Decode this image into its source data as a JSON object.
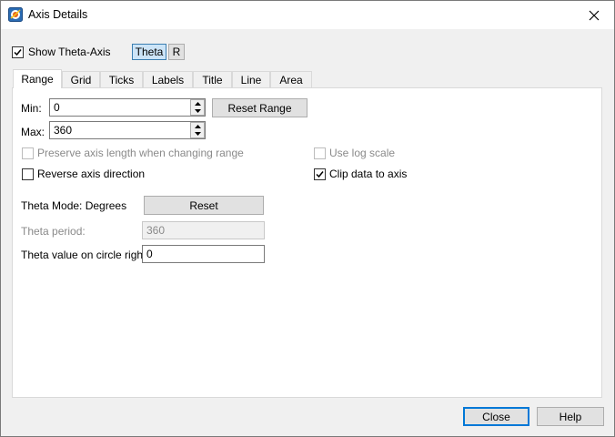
{
  "window": {
    "title": "Axis Details"
  },
  "header": {
    "show_axis_label": "Show Theta-Axis",
    "show_axis_checked": true,
    "axis_buttons": [
      "Theta",
      "R"
    ],
    "selected_axis": "Theta"
  },
  "tabs": [
    "Range",
    "Grid",
    "Ticks",
    "Labels",
    "Title",
    "Line",
    "Area"
  ],
  "active_tab": "Range",
  "range": {
    "min_label": "Min:",
    "min_value": "0",
    "max_label": "Max:",
    "max_value": "360",
    "reset_range_label": "Reset Range",
    "preserve_label": "Preserve axis length when changing range",
    "preserve_checked": false,
    "use_log_label": "Use log scale",
    "use_log_checked": false,
    "reverse_label": "Reverse axis direction",
    "reverse_checked": false,
    "clip_label": "Clip data to axis",
    "clip_checked": true,
    "theta_mode_label": "Theta Mode: Degrees",
    "reset_label": "Reset",
    "theta_period_label": "Theta period:",
    "theta_period_value": "360",
    "theta_circle_label": "Theta value on circle right:",
    "theta_circle_value": "0"
  },
  "footer": {
    "close_label": "Close",
    "help_label": "Help"
  },
  "colors": {
    "accent": "#0078d7",
    "toggle_on_bg": "#cce4f7",
    "disabled_text": "#8a8a8a"
  }
}
